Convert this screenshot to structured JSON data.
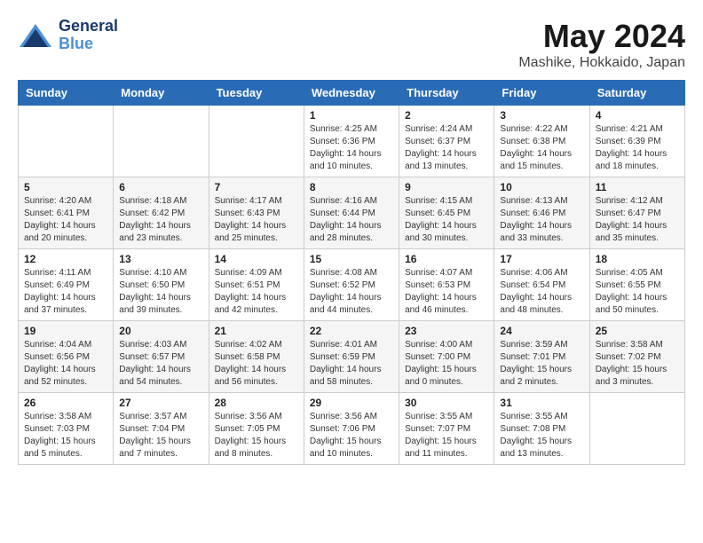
{
  "header": {
    "logo_line1": "General",
    "logo_line2": "Blue",
    "month_year": "May 2024",
    "location": "Mashike, Hokkaido, Japan"
  },
  "weekdays": [
    "Sunday",
    "Monday",
    "Tuesday",
    "Wednesday",
    "Thursday",
    "Friday",
    "Saturday"
  ],
  "weeks": [
    [
      {
        "day": "",
        "info": ""
      },
      {
        "day": "",
        "info": ""
      },
      {
        "day": "",
        "info": ""
      },
      {
        "day": "1",
        "info": "Sunrise: 4:25 AM\nSunset: 6:36 PM\nDaylight: 14 hours\nand 10 minutes."
      },
      {
        "day": "2",
        "info": "Sunrise: 4:24 AM\nSunset: 6:37 PM\nDaylight: 14 hours\nand 13 minutes."
      },
      {
        "day": "3",
        "info": "Sunrise: 4:22 AM\nSunset: 6:38 PM\nDaylight: 14 hours\nand 15 minutes."
      },
      {
        "day": "4",
        "info": "Sunrise: 4:21 AM\nSunset: 6:39 PM\nDaylight: 14 hours\nand 18 minutes."
      }
    ],
    [
      {
        "day": "5",
        "info": "Sunrise: 4:20 AM\nSunset: 6:41 PM\nDaylight: 14 hours\nand 20 minutes."
      },
      {
        "day": "6",
        "info": "Sunrise: 4:18 AM\nSunset: 6:42 PM\nDaylight: 14 hours\nand 23 minutes."
      },
      {
        "day": "7",
        "info": "Sunrise: 4:17 AM\nSunset: 6:43 PM\nDaylight: 14 hours\nand 25 minutes."
      },
      {
        "day": "8",
        "info": "Sunrise: 4:16 AM\nSunset: 6:44 PM\nDaylight: 14 hours\nand 28 minutes."
      },
      {
        "day": "9",
        "info": "Sunrise: 4:15 AM\nSunset: 6:45 PM\nDaylight: 14 hours\nand 30 minutes."
      },
      {
        "day": "10",
        "info": "Sunrise: 4:13 AM\nSunset: 6:46 PM\nDaylight: 14 hours\nand 33 minutes."
      },
      {
        "day": "11",
        "info": "Sunrise: 4:12 AM\nSunset: 6:47 PM\nDaylight: 14 hours\nand 35 minutes."
      }
    ],
    [
      {
        "day": "12",
        "info": "Sunrise: 4:11 AM\nSunset: 6:49 PM\nDaylight: 14 hours\nand 37 minutes."
      },
      {
        "day": "13",
        "info": "Sunrise: 4:10 AM\nSunset: 6:50 PM\nDaylight: 14 hours\nand 39 minutes."
      },
      {
        "day": "14",
        "info": "Sunrise: 4:09 AM\nSunset: 6:51 PM\nDaylight: 14 hours\nand 42 minutes."
      },
      {
        "day": "15",
        "info": "Sunrise: 4:08 AM\nSunset: 6:52 PM\nDaylight: 14 hours\nand 44 minutes."
      },
      {
        "day": "16",
        "info": "Sunrise: 4:07 AM\nSunset: 6:53 PM\nDaylight: 14 hours\nand 46 minutes."
      },
      {
        "day": "17",
        "info": "Sunrise: 4:06 AM\nSunset: 6:54 PM\nDaylight: 14 hours\nand 48 minutes."
      },
      {
        "day": "18",
        "info": "Sunrise: 4:05 AM\nSunset: 6:55 PM\nDaylight: 14 hours\nand 50 minutes."
      }
    ],
    [
      {
        "day": "19",
        "info": "Sunrise: 4:04 AM\nSunset: 6:56 PM\nDaylight: 14 hours\nand 52 minutes."
      },
      {
        "day": "20",
        "info": "Sunrise: 4:03 AM\nSunset: 6:57 PM\nDaylight: 14 hours\nand 54 minutes."
      },
      {
        "day": "21",
        "info": "Sunrise: 4:02 AM\nSunset: 6:58 PM\nDaylight: 14 hours\nand 56 minutes."
      },
      {
        "day": "22",
        "info": "Sunrise: 4:01 AM\nSunset: 6:59 PM\nDaylight: 14 hours\nand 58 minutes."
      },
      {
        "day": "23",
        "info": "Sunrise: 4:00 AM\nSunset: 7:00 PM\nDaylight: 15 hours\nand 0 minutes."
      },
      {
        "day": "24",
        "info": "Sunrise: 3:59 AM\nSunset: 7:01 PM\nDaylight: 15 hours\nand 2 minutes."
      },
      {
        "day": "25",
        "info": "Sunrise: 3:58 AM\nSunset: 7:02 PM\nDaylight: 15 hours\nand 3 minutes."
      }
    ],
    [
      {
        "day": "26",
        "info": "Sunrise: 3:58 AM\nSunset: 7:03 PM\nDaylight: 15 hours\nand 5 minutes."
      },
      {
        "day": "27",
        "info": "Sunrise: 3:57 AM\nSunset: 7:04 PM\nDaylight: 15 hours\nand 7 minutes."
      },
      {
        "day": "28",
        "info": "Sunrise: 3:56 AM\nSunset: 7:05 PM\nDaylight: 15 hours\nand 8 minutes."
      },
      {
        "day": "29",
        "info": "Sunrise: 3:56 AM\nSunset: 7:06 PM\nDaylight: 15 hours\nand 10 minutes."
      },
      {
        "day": "30",
        "info": "Sunrise: 3:55 AM\nSunset: 7:07 PM\nDaylight: 15 hours\nand 11 minutes."
      },
      {
        "day": "31",
        "info": "Sunrise: 3:55 AM\nSunset: 7:08 PM\nDaylight: 15 hours\nand 13 minutes."
      },
      {
        "day": "",
        "info": ""
      }
    ]
  ]
}
